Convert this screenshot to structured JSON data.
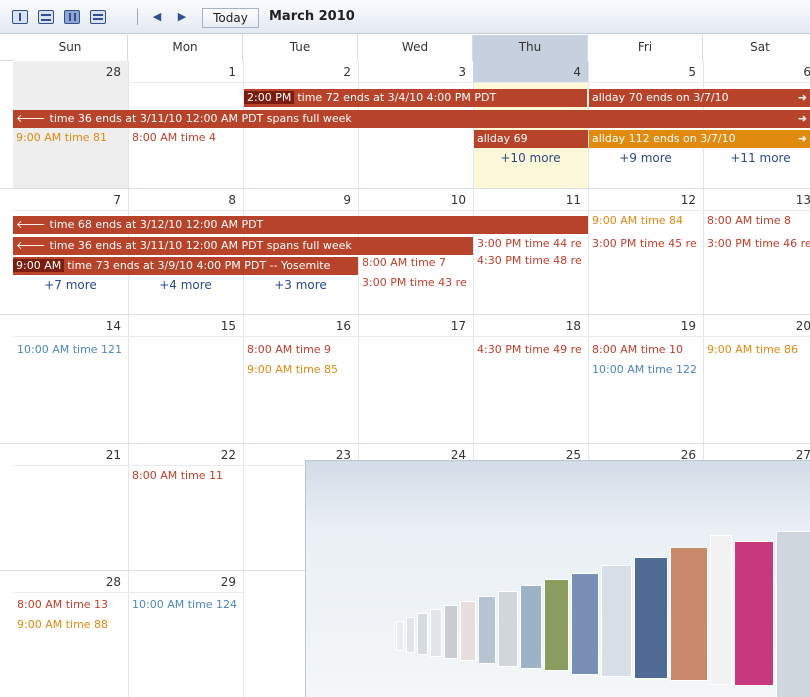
{
  "toolbar": {
    "view_icons": [
      "day-view-icon",
      "week-view-icon",
      "month-view-icon",
      "list-view-icon"
    ],
    "prev_icon": "prev-arrow-icon",
    "next_icon": "next-arrow-icon",
    "today_label": "Today",
    "month_title": "March 2010"
  },
  "weekdays": [
    "Sun",
    "Mon",
    "Tue",
    "Wed",
    "Thu",
    "Fri",
    "Sat"
  ],
  "weeks": [
    {
      "days": [
        "28",
        "1",
        "2",
        "3",
        "4",
        "5",
        "6"
      ]
    },
    {
      "days": [
        "7",
        "8",
        "9",
        "10",
        "11",
        "12",
        "13"
      ]
    },
    {
      "days": [
        "14",
        "15",
        "16",
        "17",
        "18",
        "19",
        "20"
      ]
    },
    {
      "days": [
        "21",
        "22",
        "23",
        "24",
        "25",
        "26",
        "27"
      ]
    },
    {
      "days": [
        "28",
        "29",
        "",
        "",
        "",
        "",
        ""
      ]
    }
  ],
  "bars": {
    "w1_b1_time": "2:00 PM",
    "w1_b1_text": "time 72 ends at 3/4/10 4:00 PM PDT",
    "w1_b2_text": "allday 70 ends on 3/7/10",
    "w1_b3_text": "time 36 ends at 3/11/10 12:00 AM PDT spans full week",
    "w1_b4_text": "allday 69",
    "w1_b5_text": "allday 112 ends on 3/7/10",
    "w2_b1_text": "time 68 ends at 3/12/10 12:00 AM PDT",
    "w2_b2_text": "time 36 ends at 3/11/10 12:00 AM PDT spans full week",
    "w2_b3_time": "9:00 AM",
    "w2_b3_text": "time 73 ends at 3/9/10 4:00 PM PDT -- Yosemite"
  },
  "events": {
    "w1_sun": "9:00 AM time 81",
    "w1_mon": "8:00 AM time 4",
    "w2_wed1": "8:00 AM time 7",
    "w2_wed2": "3:00 PM time 43 re",
    "w2_thu1": "3:00 PM time 44 re",
    "w2_thu2": "4:30 PM time 48 re",
    "w2_fri1": "9:00 AM time 84",
    "w2_fri2": "3:00 PM time 45 re",
    "w2_sat1": "8:00 AM time 8",
    "w2_sat2": "3:00 PM time 46 re",
    "w3_sun": "10:00 AM time 121",
    "w3_tue1": "8:00 AM time 9",
    "w3_tue2": "9:00 AM time 85",
    "w3_thu": "4:30 PM time 49 re",
    "w3_fri1": "8:00 AM time 10",
    "w3_fri2": "10:00 AM time 122",
    "w3_sat": "9:00 AM time 86",
    "w4_mon": "8:00 AM time 11",
    "w5_sun1": "8:00 AM time 13",
    "w5_sun2": "9:00 AM time 88",
    "w5_mon": "10:00 AM time 124"
  },
  "more": {
    "w1_thu": "+10 more",
    "w1_fri": "+9 more",
    "w1_sat": "+11 more",
    "w2_sun": "+7 more",
    "w2_mon": "+4 more",
    "w2_tue": "+3 more"
  },
  "colors": {
    "event_red": "#c23e2b",
    "event_orange": "#e08a10",
    "event_blue": "#4d86bd",
    "bar_red": "#b8432b",
    "bar_orange": "#e08a10",
    "today_header": "#c6d0df"
  }
}
